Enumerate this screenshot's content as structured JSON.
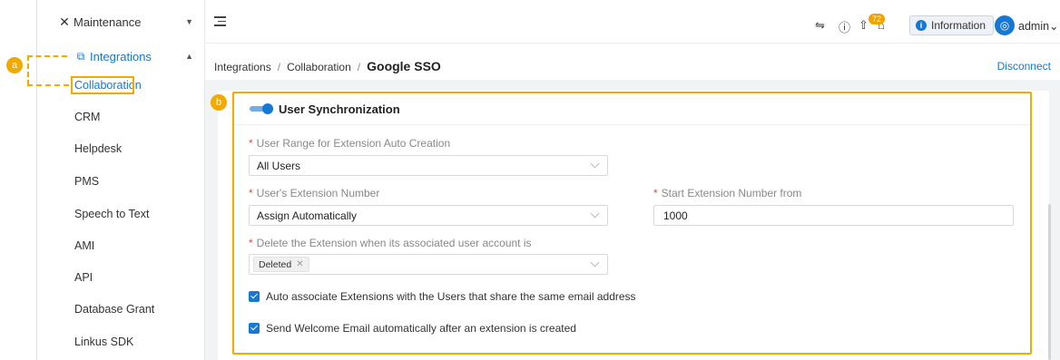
{
  "sidebar": {
    "maintenance": {
      "label": "Maintenance",
      "icon": "wrench-cross-icon"
    },
    "integrations": {
      "label": "Integrations",
      "icon": "integrations-icon"
    },
    "sub_items": [
      "Collaboration",
      "CRM",
      "Helpdesk",
      "PMS",
      "Speech to Text",
      "AMI",
      "API",
      "Database Grant",
      "Linkus SDK"
    ],
    "active_item": "Collaboration"
  },
  "topbar": {
    "notification_count": "72",
    "information_label": "Information",
    "user_label": "admin"
  },
  "breadcrumb": {
    "items": [
      "Integrations",
      "Collaboration"
    ],
    "current": "Google SSO",
    "separator": "/"
  },
  "actions": {
    "disconnect_label": "Disconnect"
  },
  "user_sync": {
    "title": "User Synchronization",
    "enabled": true,
    "range_label": "User Range for Extension Auto Creation",
    "range_value": "All Users",
    "ext_number_label": "User's Extension Number",
    "ext_number_value": "Assign Automatically",
    "start_ext_label": "Start Extension Number from",
    "start_ext_value": "1000",
    "delete_label": "Delete the Extension when its associated user account is",
    "delete_tag": "Deleted",
    "auto_associate_label": "Auto associate Extensions with the Users that share the same email address",
    "welcome_email_label": "Send Welcome Email automatically after an extension is created"
  },
  "annotations": {
    "a": "a",
    "b": "b"
  },
  "colors": {
    "accent": "#1677d4",
    "annotation": "#f2a900",
    "required": "#e5484d"
  }
}
